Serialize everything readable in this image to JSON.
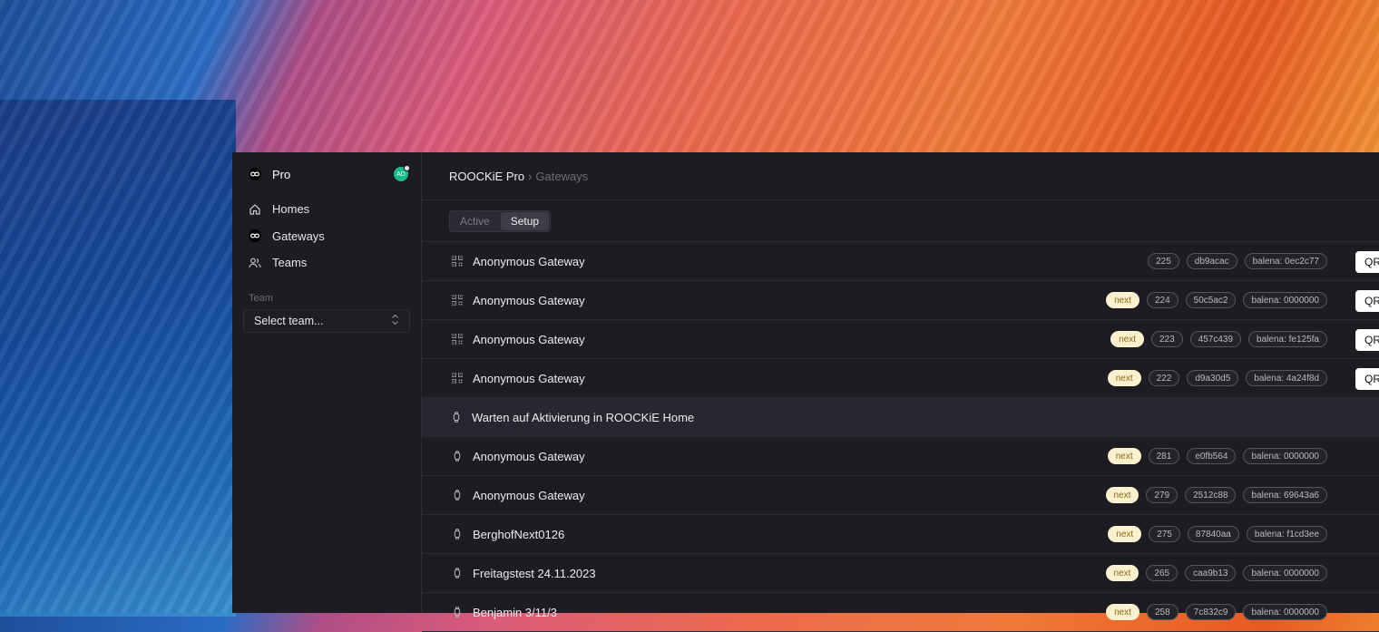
{
  "app": {
    "name": "Pro",
    "avatar_initials": "AD"
  },
  "sidebar": {
    "items": [
      {
        "label": "Homes",
        "icon": "home-icon"
      },
      {
        "label": "Gateways",
        "icon": "gateway-icon"
      },
      {
        "label": "Teams",
        "icon": "users-icon"
      }
    ],
    "team_label": "Team",
    "team_select": "Select team..."
  },
  "breadcrumb": {
    "root": "ROOCKiE Pro",
    "separator": "›",
    "current": "Gateways"
  },
  "tabs": [
    {
      "label": "Active",
      "active": false
    },
    {
      "label": "Setup",
      "active": true
    }
  ],
  "qr_label": "QR",
  "setup_rows": [
    {
      "name": "Anonymous Gateway",
      "next": false,
      "chips": [
        "225",
        "db9acac",
        "balena: 0ec2c77"
      ]
    },
    {
      "name": "Anonymous Gateway",
      "next": true,
      "chips": [
        "224",
        "50c5ac2",
        "balena: 0000000"
      ]
    },
    {
      "name": "Anonymous Gateway",
      "next": true,
      "chips": [
        "223",
        "457c439",
        "balena: fe125fa"
      ]
    },
    {
      "name": "Anonymous Gateway",
      "next": true,
      "chips": [
        "222",
        "d9a30d5",
        "balena: 4a24f8d"
      ]
    }
  ],
  "next_label": "next",
  "group_header": "Warten auf Aktivierung in ROOCKiE Home",
  "waiting_rows": [
    {
      "name": "Anonymous Gateway",
      "chips": [
        "281",
        "e0fb564",
        "balena: 0000000"
      ]
    },
    {
      "name": "Anonymous Gateway",
      "chips": [
        "279",
        "2512c88",
        "balena: 69643a6"
      ]
    },
    {
      "name": "BerghofNext0126",
      "chips": [
        "275",
        "87840aa",
        "balena: f1cd3ee"
      ]
    },
    {
      "name": "Freitagstest 24.11.2023",
      "chips": [
        "265",
        "caa9b13",
        "balena: 0000000"
      ]
    },
    {
      "name": "Benjamin 3/11/3",
      "chips": [
        "258",
        "7c832c9",
        "balena: 0000000"
      ]
    }
  ]
}
